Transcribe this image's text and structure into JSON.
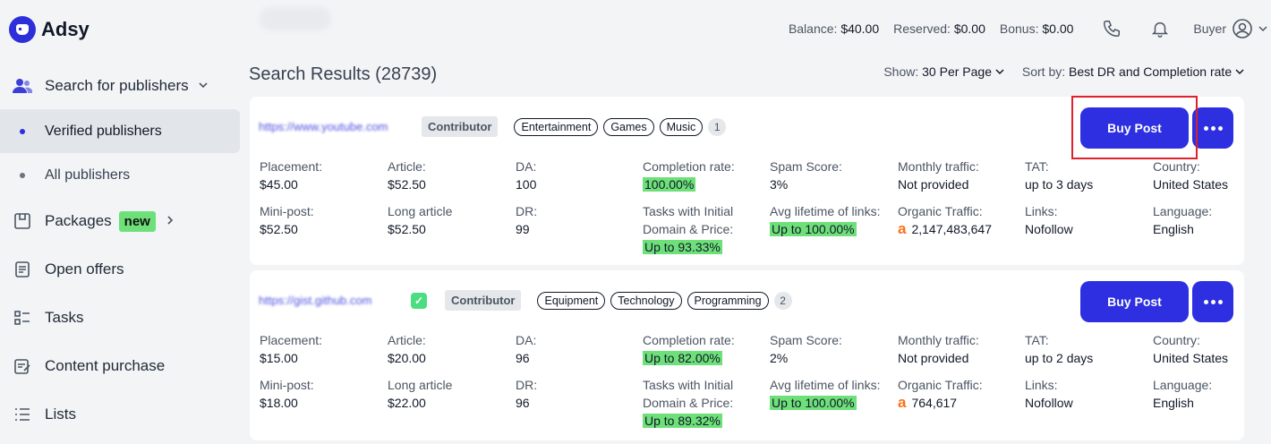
{
  "app": {
    "name": "Adsy"
  },
  "header": {
    "balance_label": "Balance:",
    "balance": "$40.00",
    "reserved_label": "Reserved:",
    "reserved": "$0.00",
    "bonus_label": "Bonus:",
    "bonus": "$0.00",
    "role": "Buyer"
  },
  "sidebar": {
    "search": "Search for publishers",
    "verified": "Verified publishers",
    "all": "All publishers",
    "packages": "Packages",
    "packages_badge": "new",
    "open_offers": "Open offers",
    "tasks": "Tasks",
    "content_purchase": "Content purchase",
    "lists": "Lists"
  },
  "results": {
    "title": "Search Results (28739)",
    "show_label": "Show:",
    "show_value": "30 Per Page",
    "sort_label": "Sort by:",
    "sort_value": "Best DR and Completion rate"
  },
  "labels": {
    "placement": "Placement:",
    "article": "Article:",
    "da": "DA:",
    "completion": "Completion rate:",
    "spam": "Spam Score:",
    "monthly": "Monthly traffic:",
    "tat": "TAT:",
    "country": "Country:",
    "mini": "Mini-post:",
    "long": "Long article",
    "dr": "DR:",
    "tasks1": "Tasks with Initial",
    "tasks2": "Domain & Price:",
    "lifetime": "Avg lifetime of links:",
    "organic": "Organic Traffic:",
    "links": "Links:",
    "language": "Language:",
    "buy": "Buy Post"
  },
  "cards": [
    {
      "url": "https://www.youtube.com",
      "role": "Contributor",
      "tags": [
        "Entertainment",
        "Games",
        "Music"
      ],
      "extra": "1",
      "placement": "$45.00",
      "article": "$52.50",
      "da": "100",
      "completion": "100.00%",
      "spam": "3%",
      "monthly": "Not provided",
      "tat": "up to 3 days",
      "country": "United States",
      "mini": "$52.50",
      "long": "$52.50",
      "dr": "99",
      "tasks": "Up to 93.33%",
      "lifetime": "Up to 100.00%",
      "organic": "2,147,483,647",
      "links": "Nofollow",
      "language": "English"
    },
    {
      "url": "https://gist.github.com",
      "role": "Contributor",
      "tags": [
        "Equipment",
        "Technology",
        "Programming"
      ],
      "extra": "2",
      "placement": "$15.00",
      "article": "$20.00",
      "da": "96",
      "completion": "Up to 82.00%",
      "spam": "2%",
      "monthly": "Not provided",
      "tat": "up to 2 days",
      "country": "United States",
      "mini": "$18.00",
      "long": "$22.00",
      "dr": "96",
      "tasks": "Up to 89.32%",
      "lifetime": "Up to 100.00%",
      "organic": "764,617",
      "links": "Nofollow",
      "language": "English"
    }
  ]
}
